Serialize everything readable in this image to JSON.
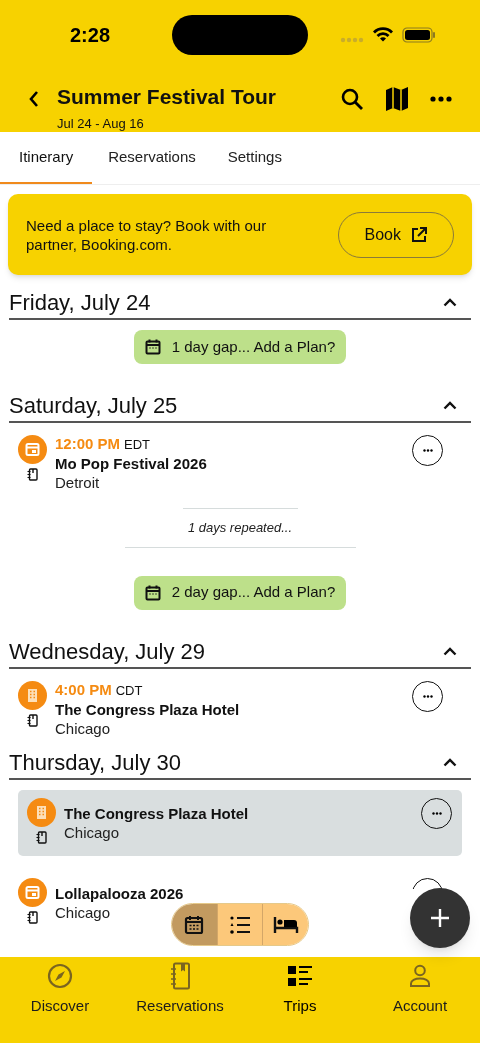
{
  "status_bar": {
    "time": "2:28"
  },
  "header": {
    "title": "Summer Festival Tour",
    "subtitle": "Jul 24 - Aug 16"
  },
  "tabs": [
    {
      "label": "Itinerary",
      "selected": true
    },
    {
      "label": "Reservations",
      "selected": false
    },
    {
      "label": "Settings",
      "selected": false
    }
  ],
  "promo": {
    "text": "Need a place to stay? Book with our partner, Booking.com.",
    "button": "Book"
  },
  "timeline": [
    {
      "kind": "day",
      "title": "Friday, July 24",
      "expanded": true
    },
    {
      "kind": "gap",
      "text": "1 day gap... Add a Plan?"
    },
    {
      "kind": "day",
      "title": "Saturday, July 25",
      "expanded": true
    },
    {
      "kind": "event",
      "time": "12:00 PM",
      "timezone": "EDT",
      "title": "Mo Pop Festival 2026",
      "location": "Detroit",
      "highlighted": false
    },
    {
      "kind": "repeated",
      "text": "1 days repeated..."
    },
    {
      "kind": "gap",
      "text": "2 day gap... Add a Plan?"
    },
    {
      "kind": "day",
      "title": "Wednesday, July 29",
      "expanded": true
    },
    {
      "kind": "stay",
      "time": "4:00 PM",
      "timezone": "CDT",
      "title": "The Congress Plaza Hotel",
      "location": "Chicago",
      "highlighted": false
    },
    {
      "kind": "day",
      "title": "Thursday, July 30",
      "expanded": true
    },
    {
      "kind": "stay",
      "title": "The Congress Plaza Hotel",
      "location": "Chicago",
      "highlighted": true
    },
    {
      "kind": "event",
      "title": "Lollapalooza 2026",
      "location": "Chicago",
      "highlighted": false
    }
  ],
  "view_switcher": [
    {
      "kind": "calendar",
      "selected": true
    },
    {
      "kind": "list",
      "selected": false
    },
    {
      "kind": "bed",
      "selected": false
    }
  ],
  "bottom_nav": [
    {
      "kind": "compass",
      "label": "Discover",
      "selected": false
    },
    {
      "kind": "notebook",
      "label": "Reservations",
      "selected": false
    },
    {
      "kind": "trips",
      "label": "Trips",
      "selected": true
    },
    {
      "kind": "person",
      "label": "Account",
      "selected": false
    }
  ]
}
